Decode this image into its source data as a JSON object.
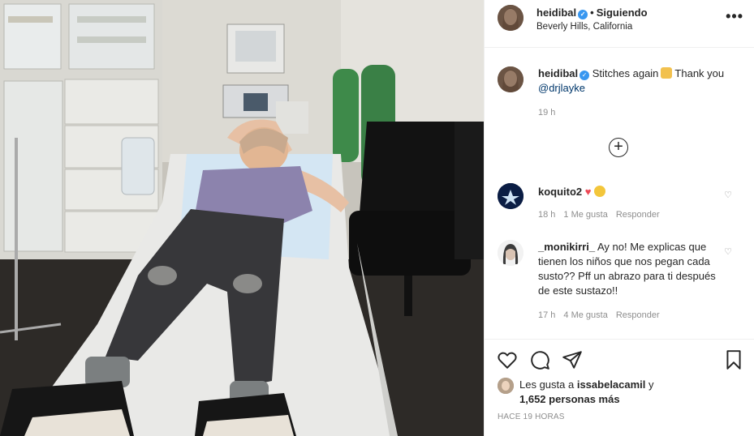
{
  "post": {
    "username": "heidibal",
    "follow_status": "Siguiendo",
    "location": "Beverly Hills, California",
    "more_icon": "ellipsis-icon",
    "verified_icon": "verified-badge-icon"
  },
  "caption": {
    "username": "heidibal",
    "text_before": "Stitches again",
    "text_after": "Thank you",
    "mention": "@drjlayke",
    "emoji": "person-emoji",
    "time": "19 h"
  },
  "load_more_icon": "plus-circle-icon",
  "comments": [
    {
      "username": "koquito2",
      "text": "",
      "emojis": [
        "heart-emoji",
        "sun-emoji"
      ],
      "heart_glyph": "♥",
      "time": "18 h",
      "likes": "1 Me gusta",
      "reply": "Responder"
    },
    {
      "username": "_monikirri_",
      "text": "Ay no! Me explicas que tienen los niños que nos pegan cada susto?? Pff un abrazo para ti después de este sustazo!!",
      "time": "17 h",
      "likes": "4 Me gusta",
      "reply": "Responder"
    }
  ],
  "actions": {
    "like_icon": "heart-icon",
    "comment_icon": "comment-icon",
    "share_icon": "share-icon",
    "save_icon": "bookmark-icon"
  },
  "likes": {
    "prefix": "Les gusta a",
    "first_user": "issabelacamil",
    "conj": "y",
    "others": "1,652 personas más"
  },
  "timestamp": "HACE 19 HORAS",
  "colors": {
    "link": "#00376b",
    "verified": "#3897f0",
    "muted": "#8e8e8e",
    "heart": "#ed4956"
  }
}
